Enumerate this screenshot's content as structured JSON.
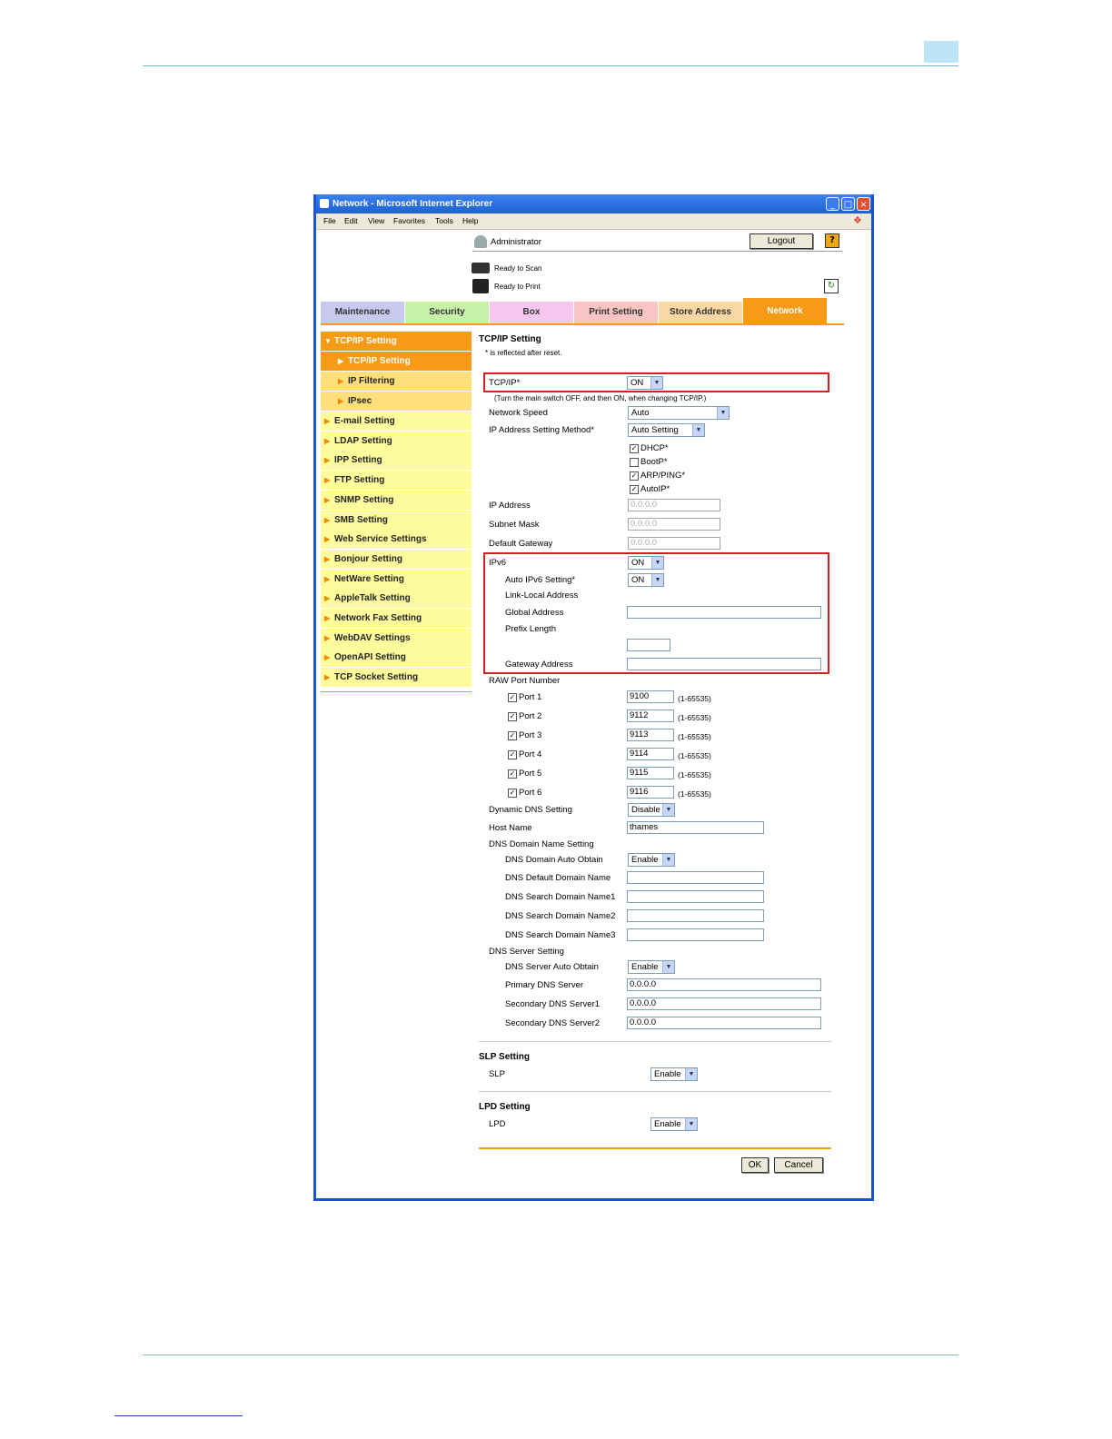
{
  "window": {
    "title": "Network - Microsoft Internet Explorer"
  },
  "menu": [
    "File",
    "Edit",
    "View",
    "Favorites",
    "Tools",
    "Help"
  ],
  "header": {
    "user": "Administrator",
    "logout": "Logout",
    "help": "?",
    "status_scan": "Ready to Scan",
    "status_print": "Ready to Print"
  },
  "tabs": [
    {
      "label": "Maintenance",
      "color": "#c9c9f0"
    },
    {
      "label": "Security",
      "color": "#c7f0a8"
    },
    {
      "label": "Box",
      "color": "#f7c7f0"
    },
    {
      "label": "Print Setting",
      "color": "#f8c4c4"
    },
    {
      "label": "Store Address",
      "color": "#fad7a3"
    },
    {
      "label": "Network",
      "color": "#f79a16"
    }
  ],
  "sidebar": {
    "items": [
      "TCP/IP Setting",
      "TCP/IP Setting",
      "IP Filtering",
      "IPsec",
      "E-mail Setting",
      "LDAP Setting",
      "IPP Setting",
      "FTP Setting",
      "SNMP Setting",
      "SMB Setting",
      "Web Service Settings",
      "Bonjour Setting",
      "NetWare Setting",
      "AppleTalk Setting",
      "Network Fax Setting",
      "WebDAV Settings",
      "OpenAPI Setting",
      "TCP Socket Setting"
    ]
  },
  "form": {
    "title": "TCP/IP Setting",
    "note": "* is reflected after reset.",
    "tcpip_label": "TCP/IP*",
    "tcpip_value": "ON",
    "tcpip_note": "(Turn the main switch OFF, and then ON, when changing TCP/IP.)",
    "speed_label": "Network Speed",
    "speed_value": "Auto",
    "ipmethod_label": "IP Address Setting Method*",
    "ipmethod_value": "Auto Setting",
    "dhcp": "DHCP*",
    "bootp": "BootP*",
    "arp": "ARP/PING*",
    "autoip": "AutoIP*",
    "ip_label": "IP Address",
    "ip_value": "0.0.0.0",
    "mask_label": "Subnet Mask",
    "mask_value": "0.0.0.0",
    "gw_label": "Default Gateway",
    "gw_value": "0.0.0.0",
    "ipv6_label": "IPv6",
    "ipv6_value": "ON",
    "autoipv6_label": "Auto IPv6 Setting*",
    "autoipv6_value": "ON",
    "linklocal_label": "Link-Local Address",
    "global_label": "Global Address",
    "prefix_label": "Prefix Length",
    "gwaddr_label": "Gateway Address",
    "raw_label": "RAW Port Number",
    "ports": [
      {
        "label": "Port 1",
        "value": "9100",
        "range": "(1-65535)"
      },
      {
        "label": "Port 2",
        "value": "9112",
        "range": "(1-65535)"
      },
      {
        "label": "Port 3",
        "value": "9113",
        "range": "(1-65535)"
      },
      {
        "label": "Port 4",
        "value": "9114",
        "range": "(1-65535)"
      },
      {
        "label": "Port 5",
        "value": "9115",
        "range": "(1-65535)"
      },
      {
        "label": "Port 6",
        "value": "9116",
        "range": "(1-65535)"
      }
    ],
    "ddns_label": "Dynamic DNS Setting",
    "ddns_value": "Disable",
    "host_label": "Host Name",
    "host_value": "thames",
    "dnsdomain_label": "DNS Domain Name Setting",
    "dnsdomain_auto_label": "DNS Domain Auto Obtain",
    "dnsdomain_auto_value": "Enable",
    "dns_default_label": "DNS Default Domain Name",
    "dns_search1_label": "DNS Search Domain Name1",
    "dns_search2_label": "DNS Search Domain Name2",
    "dns_search3_label": "DNS Search Domain Name3",
    "dnsserver_label": "DNS Server Setting",
    "dnsserver_auto_label": "DNS Server Auto Obtain",
    "dnsserver_auto_value": "Enable",
    "primary_label": "Primary DNS Server",
    "primary_value": "0.0.0.0",
    "secondary1_label": "Secondary DNS Server1",
    "secondary1_value": "0.0.0.0",
    "secondary2_label": "Secondary DNS Server2",
    "secondary2_value": "0.0.0.0",
    "slp_title": "SLP Setting",
    "slp_label": "SLP",
    "slp_value": "Enable",
    "lpd_title": "LPD Setting",
    "lpd_label": "LPD",
    "lpd_value": "Enable",
    "ok": "OK",
    "cancel": "Cancel"
  }
}
